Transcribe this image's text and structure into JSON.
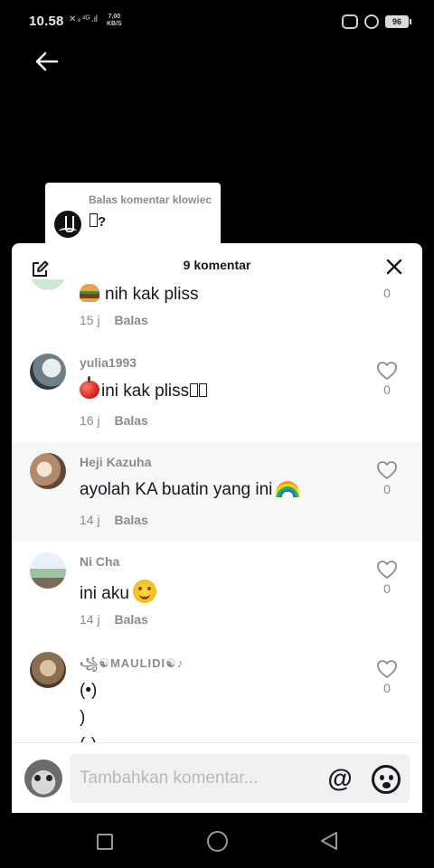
{
  "status_bar": {
    "time": "10.58",
    "network_icons": "✕ ᵢₗ ⁴ᴳ .ıl",
    "speed_value": "7,00",
    "speed_unit": "KB/S",
    "battery": "96",
    "icons": [
      "car-mode-icon",
      "privacy-icon",
      "battery-icon"
    ]
  },
  "reply_preview": {
    "title": "Balas komentar klowiec",
    "text": "?"
  },
  "sheet": {
    "title": "9 komentar",
    "icons": [
      "edit-icon",
      "close-icon"
    ]
  },
  "comments": [
    {
      "username": "",
      "text": "nih kak pliss",
      "emoji": "burger",
      "time": "15 j",
      "reply_label": "Balas",
      "likes": "0"
    },
    {
      "username": "yulia1993",
      "text": "ini kak pliss",
      "emoji": "apple",
      "time": "16 j",
      "reply_label": "Balas",
      "likes": "0"
    },
    {
      "username": "Heji Kazuha",
      "text": "ayolah KA buatin yang ini",
      "emoji": "rainbow",
      "time": "14 j",
      "reply_label": "Balas",
      "likes": "0"
    },
    {
      "username": "Ni Cha",
      "text": "ini aku",
      "emoji": "smile",
      "time": "14 j",
      "reply_label": "Balas",
      "likes": "0"
    },
    {
      "username": "꧁☯MAULIDI☯♪",
      "text_lines": [
        "(•)",
        ")",
        "(-)"
      ],
      "likes": "0"
    }
  ],
  "footer": {
    "placeholder": "Tambahkan komentar...",
    "mention_symbol": "@"
  },
  "colors": {
    "sheet_bg": "#ffffff",
    "secondary_text": "#8a8b91",
    "primary_text": "#161823"
  }
}
